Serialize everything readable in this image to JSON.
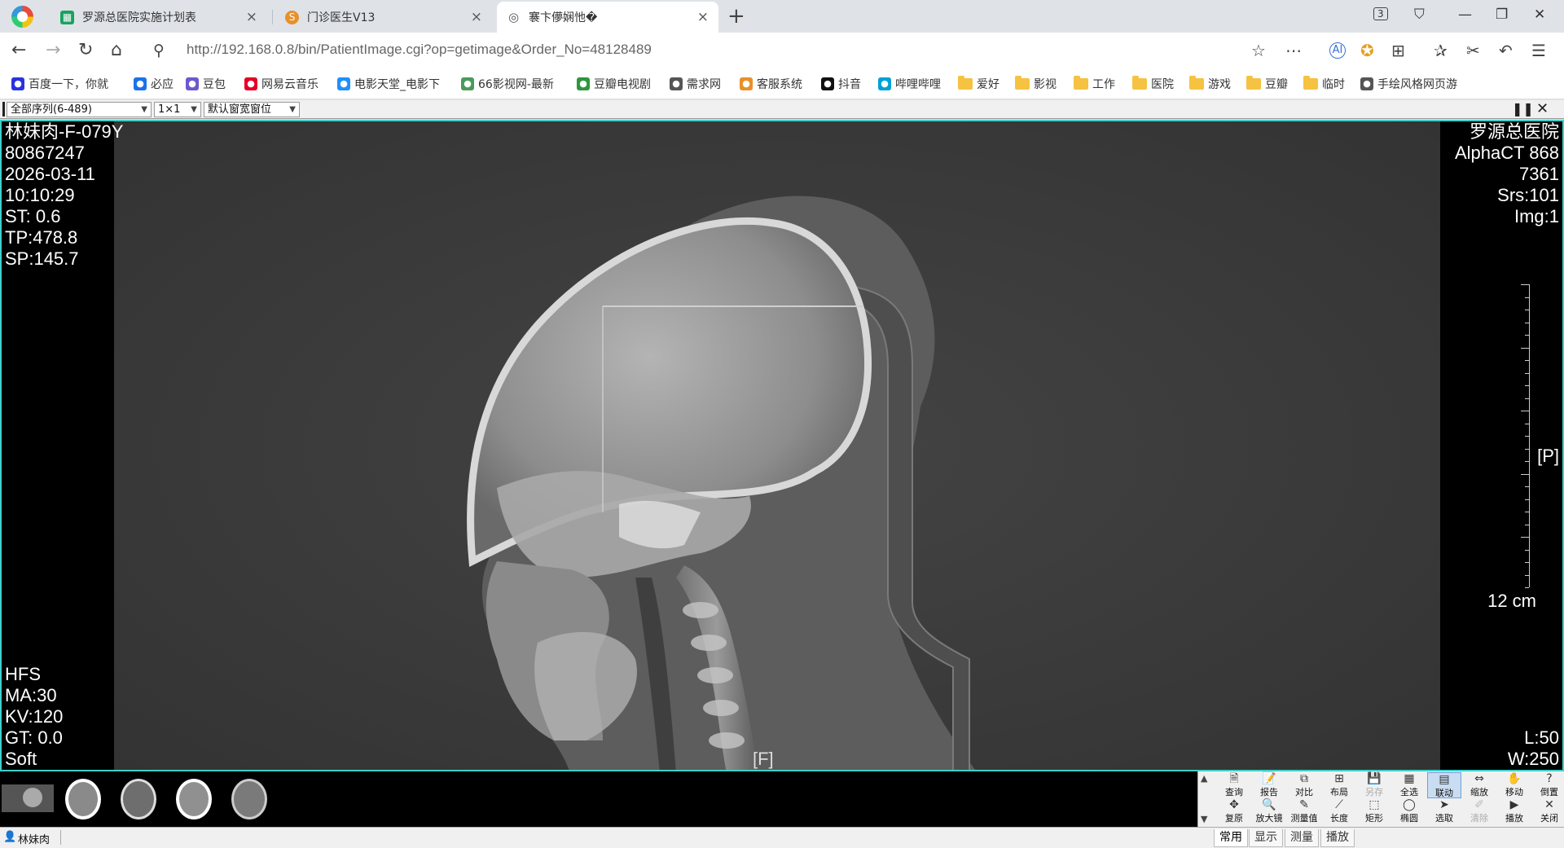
{
  "browser": {
    "tabs": [
      {
        "title": "罗源总医院实施计划表",
        "favicon": "spreadsheet-icon",
        "color": "#1aa260",
        "active": false
      },
      {
        "title": "门诊医生V13",
        "favicon": "app-icon",
        "color": "#e8902a",
        "active": false
      },
      {
        "title": "褰卞儚娴忚�",
        "favicon": "globe-icon",
        "color": "#555555",
        "active": true
      }
    ],
    "tab_count_badge": "3",
    "url": "http://192.168.0.8/bin/PatientImage.cgi?op=getimage&Order_No=48128489",
    "bookmarks": [
      {
        "label": "百度一下，你就",
        "icon": "baidu-icon",
        "color": "#2932e1"
      },
      {
        "label": "必应",
        "icon": "search-icon",
        "color": "#1a73e8"
      },
      {
        "label": "豆包",
        "icon": "doubao-icon",
        "color": "#6a5acd"
      },
      {
        "label": "网易云音乐",
        "icon": "netease-music-icon",
        "color": "#e60026"
      },
      {
        "label": "电影天堂_电影下",
        "icon": "shield-icon",
        "color": "#1e90ff"
      },
      {
        "label": "66影视网-最新",
        "icon": "film-icon",
        "color": "#4a9a5a"
      },
      {
        "label": "豆瓣电视剧",
        "icon": "douban-icon",
        "color": "#2e963d"
      },
      {
        "label": "需求网",
        "icon": "globe-icon",
        "color": "#555555"
      },
      {
        "label": "客服系统",
        "icon": "service-icon",
        "color": "#e8902a"
      },
      {
        "label": "抖音",
        "icon": "douyin-icon",
        "color": "#111111"
      },
      {
        "label": "哔哩哔哩",
        "icon": "bilibili-icon",
        "color": "#00a1d6"
      },
      {
        "label": "爱好",
        "icon": "folder-icon",
        "color": "#f5c242"
      },
      {
        "label": "影视",
        "icon": "folder-icon",
        "color": "#f5c242"
      },
      {
        "label": "工作",
        "icon": "folder-icon",
        "color": "#f5c242"
      },
      {
        "label": "医院",
        "icon": "folder-icon",
        "color": "#f5c242"
      },
      {
        "label": "游戏",
        "icon": "folder-icon",
        "color": "#f5c242"
      },
      {
        "label": "豆瓣",
        "icon": "folder-icon",
        "color": "#f5c242"
      },
      {
        "label": "临时",
        "icon": "folder-icon",
        "color": "#f5c242"
      },
      {
        "label": "手绘风格网页游",
        "icon": "globe-icon",
        "color": "#555555"
      }
    ]
  },
  "viewer": {
    "series_select": "全部序列(6-489)",
    "layout_select": "1×1",
    "window_select": "默认窗宽窗位",
    "overlay": {
      "top_left": [
        "林妹肉-F-079Y",
        "80867247",
        "2026-03-11",
        "10:10:29",
        "ST:  0.6",
        "TP:478.8",
        "SP:145.7"
      ],
      "top_right": [
        "罗源总医院",
        "AlphaCT 868",
        "7361",
        "Srs:101",
        "Img:1"
      ],
      "bottom_left": [
        "HFS",
        "MA:30",
        "KV:120",
        "GT:  0.0",
        "Soft"
      ],
      "bottom_right": [
        "L:50",
        "W:250"
      ],
      "orientation_right": "[P]",
      "orientation_bottom": "[F]",
      "scale_label": "12 cm"
    },
    "tools_row1": [
      {
        "label": "查询",
        "icon": "query-icon",
        "glyph": "🗎"
      },
      {
        "label": "报告",
        "icon": "report-icon",
        "glyph": "📝"
      },
      {
        "label": "对比",
        "icon": "compare-icon",
        "glyph": "⧉"
      },
      {
        "label": "布局",
        "icon": "layout-icon",
        "glyph": "⊞"
      },
      {
        "label": "另存",
        "icon": "save-icon",
        "glyph": "💾",
        "disabled": true
      },
      {
        "label": "全选",
        "icon": "select-all-icon",
        "glyph": "▦"
      },
      {
        "label": "联动",
        "icon": "link-icon",
        "glyph": "▤",
        "active": true
      },
      {
        "label": "缩放",
        "icon": "zoom-icon",
        "glyph": "⇔"
      },
      {
        "label": "移动",
        "icon": "hand-icon",
        "glyph": "✋"
      },
      {
        "label": "倒置",
        "icon": "invert-icon",
        "glyph": "?"
      }
    ],
    "tools_row2": [
      {
        "label": "复原",
        "icon": "reset-icon",
        "glyph": "✥"
      },
      {
        "label": "放大镜",
        "icon": "magnifier-icon",
        "glyph": "🔍"
      },
      {
        "label": "测量值",
        "icon": "measure-value-icon",
        "glyph": "✎"
      },
      {
        "label": "长度",
        "icon": "ruler-icon",
        "glyph": "⟋"
      },
      {
        "label": "矩形",
        "icon": "rectangle-icon",
        "glyph": "⬚"
      },
      {
        "label": "椭圆",
        "icon": "ellipse-icon",
        "glyph": "◯"
      },
      {
        "label": "选取",
        "icon": "pointer-icon",
        "glyph": "➤"
      },
      {
        "label": "清除",
        "icon": "eraser-icon",
        "glyph": "✐",
        "disabled": true
      },
      {
        "label": "播放",
        "icon": "play-icon",
        "glyph": "▶"
      },
      {
        "label": "关闭",
        "icon": "close-icon",
        "glyph": "✕"
      }
    ],
    "panel_tabs": [
      {
        "label": "常用",
        "active": true
      },
      {
        "label": "显示"
      },
      {
        "label": "测量"
      },
      {
        "label": "播放"
      }
    ],
    "status_patient": "林妹肉"
  }
}
